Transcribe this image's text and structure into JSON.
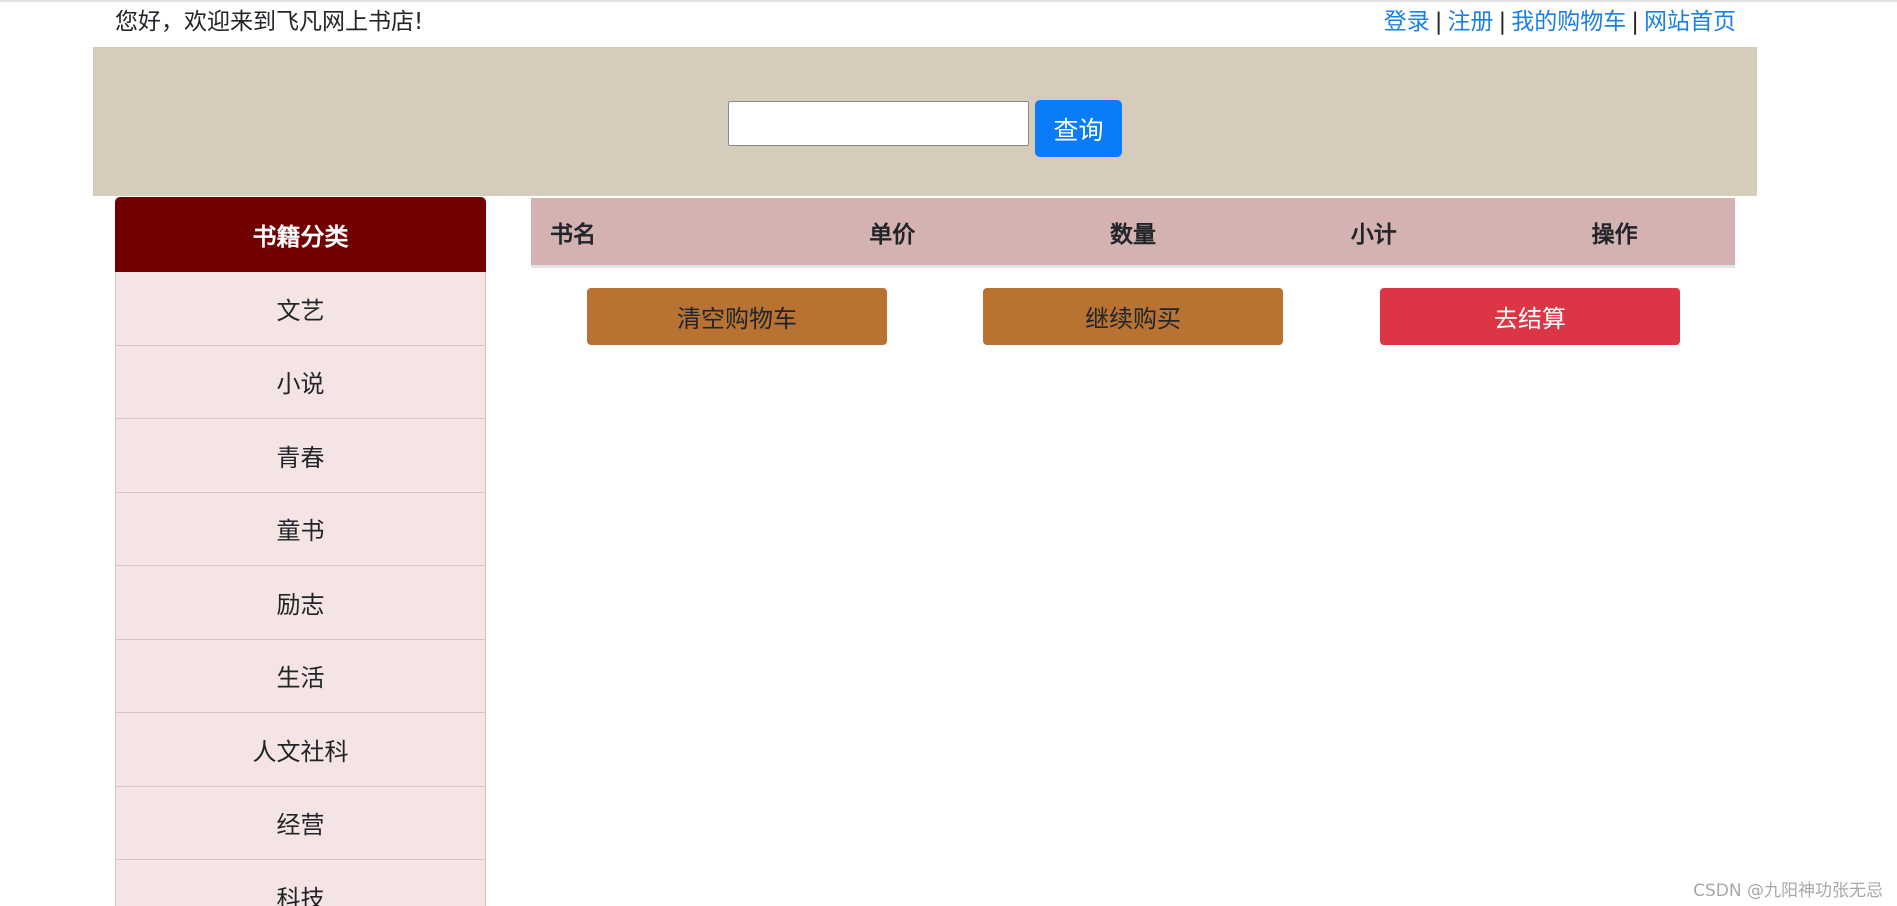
{
  "header": {
    "greeting": "您好，欢迎来到飞凡网上书店!",
    "links": [
      "登录",
      "注册",
      "我的购物车",
      "网站首页"
    ],
    "separator": "|"
  },
  "search": {
    "value": "",
    "button_label": "查询"
  },
  "sidebar": {
    "title": "书籍分类",
    "items": [
      "文艺",
      "小说",
      "青春",
      "童书",
      "励志",
      "生活",
      "人文社科",
      "经营",
      "科技"
    ]
  },
  "cart": {
    "columns": [
      "书名",
      "单价",
      "数量",
      "小计",
      "操作"
    ],
    "actions": {
      "clear": "清空购物车",
      "continue": "继续购买",
      "checkout": "去结算"
    }
  },
  "watermark": "CSDN @九阳神功张无忌",
  "colors": {
    "banner": "#d6ccbb",
    "sidebar_header": "#720000",
    "sidebar_item": "#f5e4e4",
    "table_header": "#d4b2b1",
    "search_button": "#0a7cf8",
    "link": "#1a7fe8",
    "action_brown": "#b87333",
    "checkout_red": "#dc3545"
  }
}
